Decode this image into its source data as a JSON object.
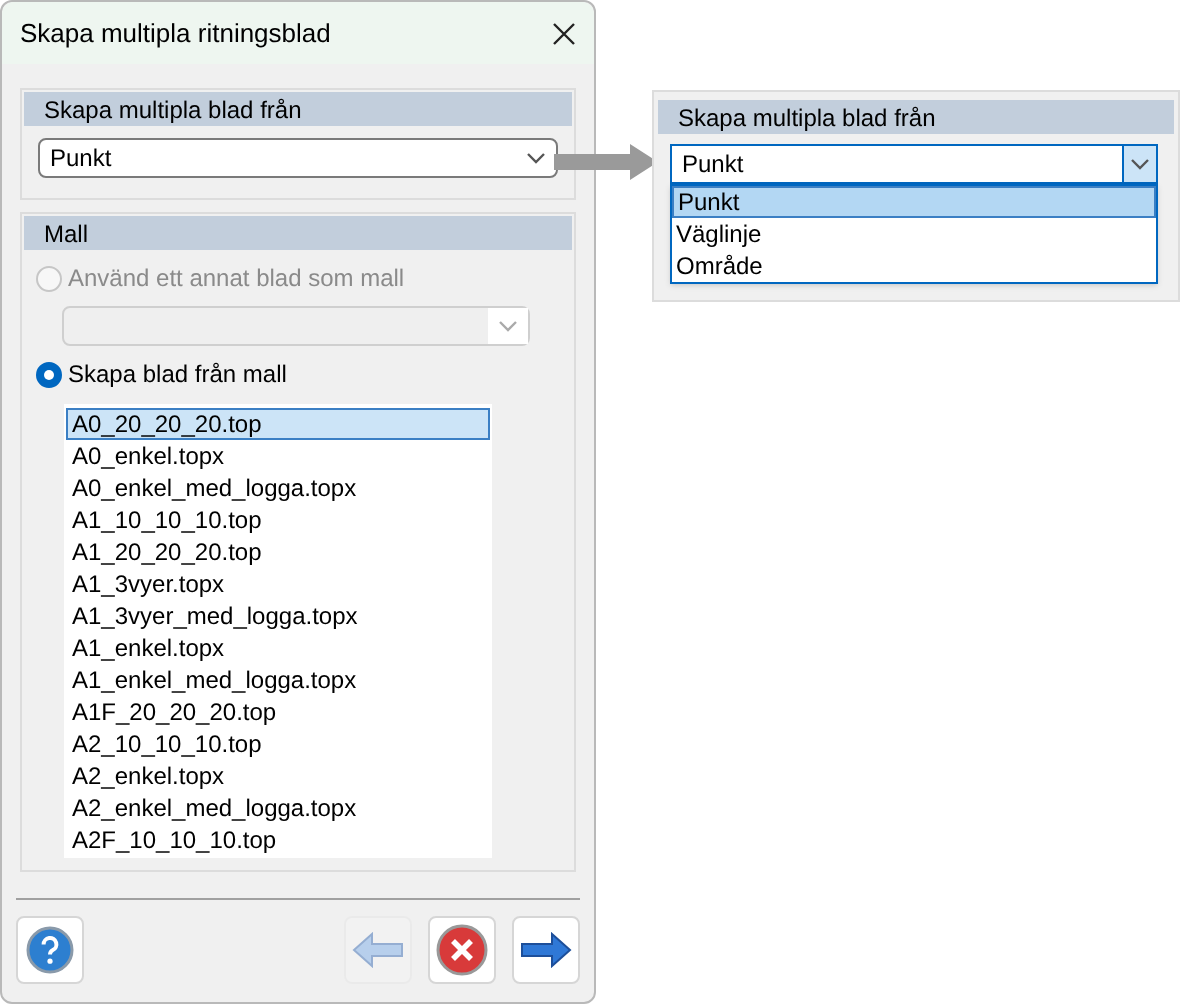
{
  "window": {
    "title": "Skapa multipla ritningsblad"
  },
  "source_section": {
    "header": "Skapa multipla blad från",
    "value": "Punkt"
  },
  "template_section": {
    "header": "Mall",
    "options": [
      {
        "label": "Använd ett annat blad som mall",
        "selected": false,
        "disabled": true
      },
      {
        "label": "Skapa blad från mall",
        "selected": true,
        "disabled": false
      }
    ],
    "templates": [
      {
        "name": "A0_20_20_20.top",
        "selected": true
      },
      {
        "name": "A0_enkel.topx",
        "selected": false
      },
      {
        "name": "A0_enkel_med_logga.topx",
        "selected": false
      },
      {
        "name": "A1_10_10_10.top",
        "selected": false
      },
      {
        "name": "A1_20_20_20.top",
        "selected": false
      },
      {
        "name": "A1_3vyer.topx",
        "selected": false
      },
      {
        "name": "A1_3vyer_med_logga.topx",
        "selected": false
      },
      {
        "name": "A1_enkel.topx",
        "selected": false
      },
      {
        "name": "A1_enkel_med_logga.topx",
        "selected": false
      },
      {
        "name": "A1F_20_20_20.top",
        "selected": false
      },
      {
        "name": "A2_10_10_10.top",
        "selected": false
      },
      {
        "name": "A2_enkel.topx",
        "selected": false
      },
      {
        "name": "A2_enkel_med_logga.topx",
        "selected": false
      },
      {
        "name": "A2F_10_10_10.top",
        "selected": false
      }
    ]
  },
  "footer": {
    "back_disabled": true
  },
  "inset": {
    "header": "Skapa multipla blad från",
    "value": "Punkt",
    "options": [
      {
        "label": "Punkt",
        "selected": true
      },
      {
        "label": "Väglinje",
        "selected": false
      },
      {
        "label": "Område",
        "selected": false
      }
    ]
  }
}
